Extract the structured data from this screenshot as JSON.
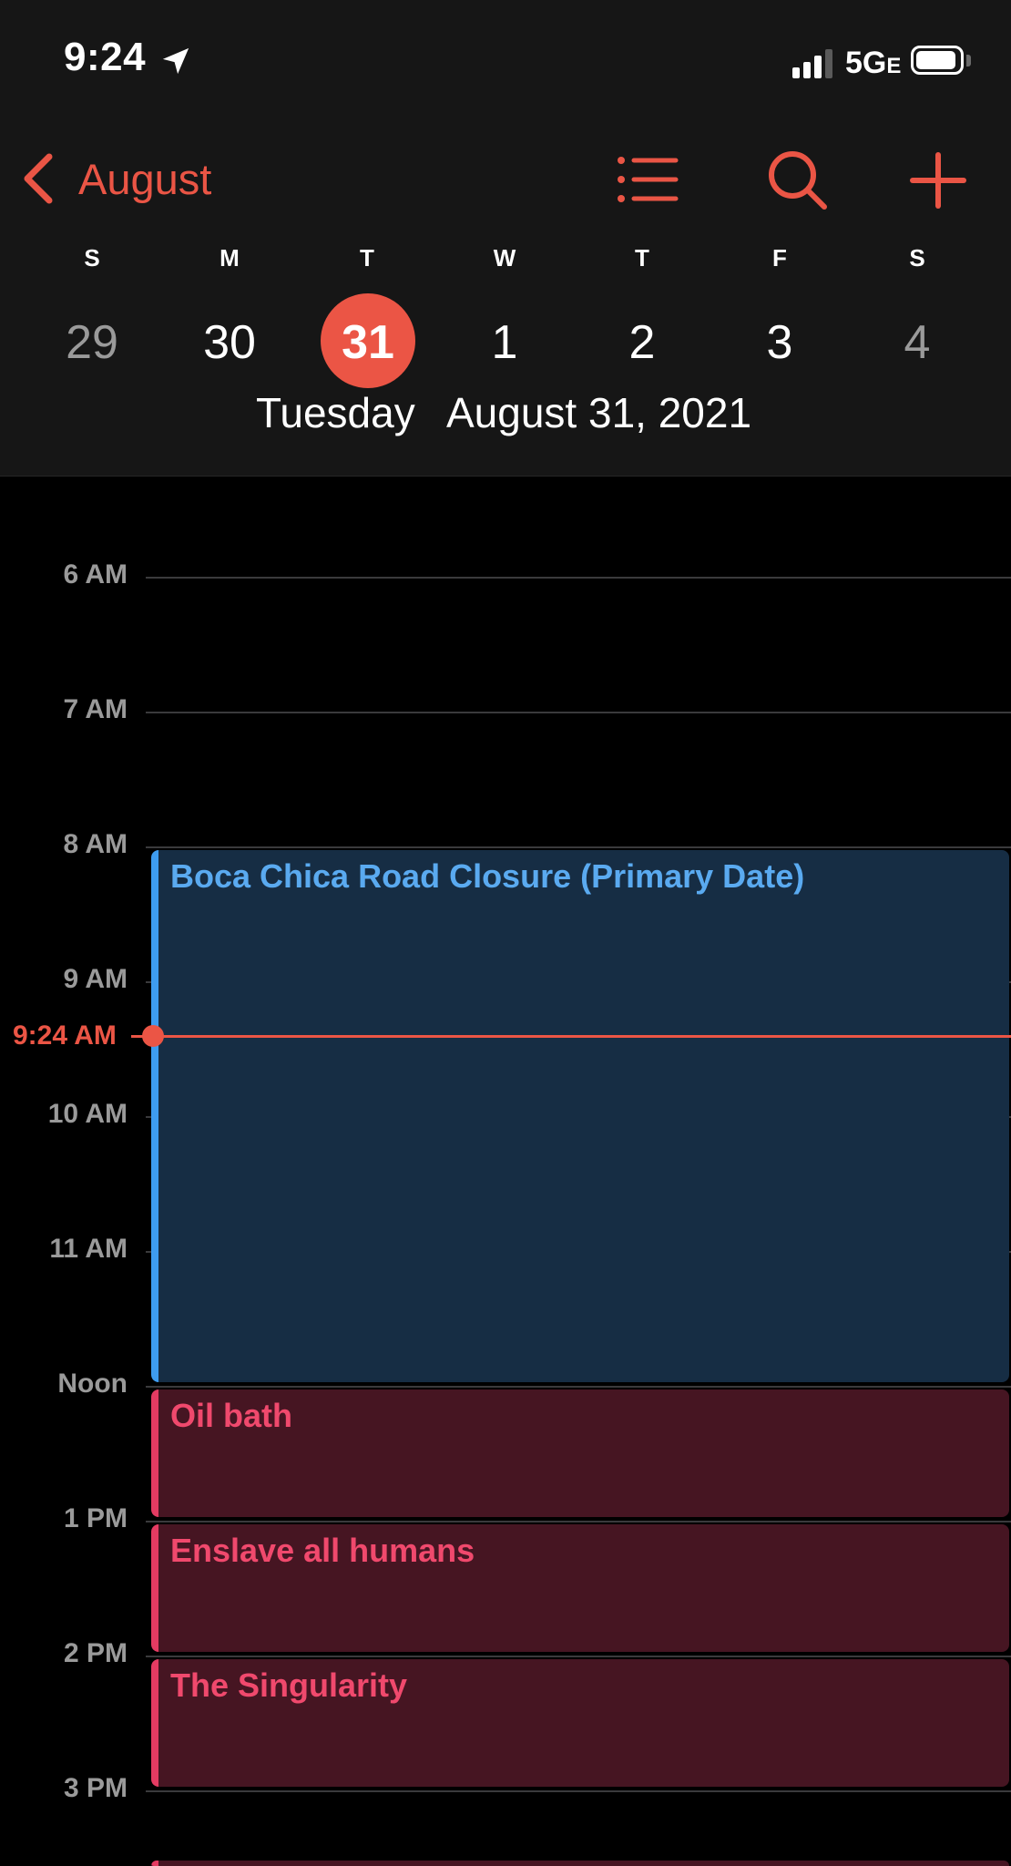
{
  "status_bar": {
    "time": "9:24",
    "network": "5G",
    "network_suffix": "E",
    "location_icon": "location-arrow-icon",
    "signal_icon": "cellular-signal-icon",
    "battery_icon": "battery-icon"
  },
  "nav": {
    "back_label": "August",
    "back_icon": "chevron-left-icon",
    "list_icon": "list-icon",
    "search_icon": "search-icon",
    "add_icon": "plus-icon"
  },
  "week": {
    "weekdays": [
      "S",
      "M",
      "T",
      "W",
      "T",
      "F",
      "S"
    ],
    "days": [
      "29",
      "30",
      "31",
      "1",
      "2",
      "3",
      "4"
    ],
    "selected_index": 2
  },
  "selected_date": {
    "weekday": "Tuesday",
    "full_date": "August 31, 2021"
  },
  "timeline": {
    "hours": [
      "6 AM",
      "7 AM",
      "8 AM",
      "9 AM",
      "10 AM",
      "11 AM",
      "Noon",
      "1 PM",
      "2 PM",
      "3 PM"
    ],
    "current_time": "9:24 AM"
  },
  "events": [
    {
      "title": "Boca Chica Road Closure (Primary Date)",
      "calendar_color": "blue"
    },
    {
      "title": "Oil bath",
      "calendar_color": "red"
    },
    {
      "title": "Enslave all humans",
      "calendar_color": "red"
    },
    {
      "title": "The Singularity",
      "calendar_color": "red"
    }
  ],
  "colors": {
    "accent": "#eb5545",
    "event_blue": "#3e9cf0",
    "event_red": "#e43b62",
    "header_bg": "#161616",
    "background": "#000000"
  }
}
